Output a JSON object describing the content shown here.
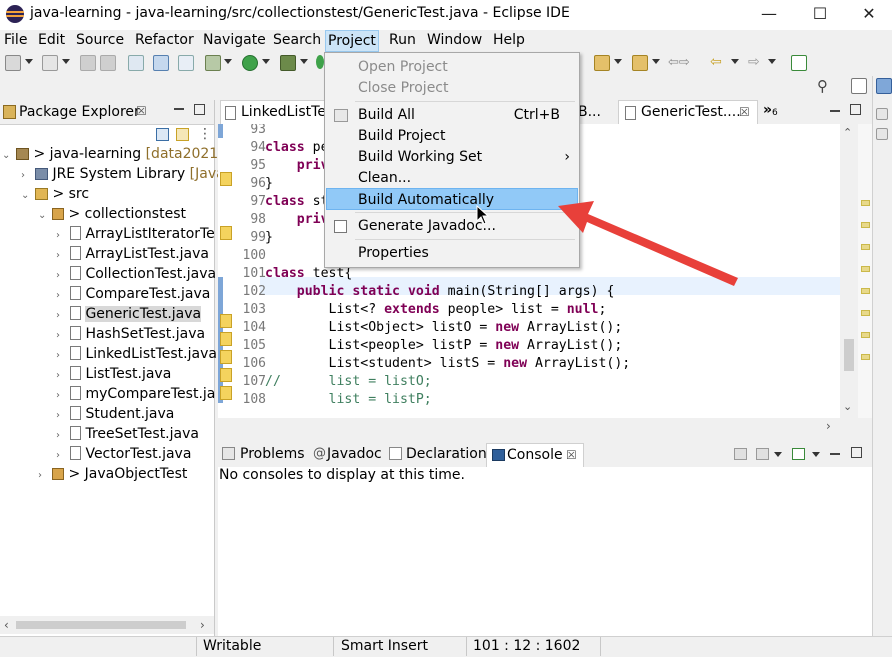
{
  "window": {
    "title": "java-learning - java-learning/src/collectionstest/GenericTest.java - Eclipse IDE",
    "minimize": "—",
    "maximize": "☐",
    "close": "✕"
  },
  "menubar": [
    "File",
    "Edit",
    "Source",
    "Refactor",
    "Navigate",
    "Search",
    "Project",
    "Run",
    "Window",
    "Help"
  ],
  "project_menu": {
    "items": [
      {
        "label": "Open Project",
        "disabled": true
      },
      {
        "label": "Close Project",
        "disabled": true
      },
      {
        "label": "Build All",
        "accel": "Ctrl+B"
      },
      {
        "label": "Build Project"
      },
      {
        "label": "Build Working Set",
        "submenu": "›"
      },
      {
        "label": "Clean..."
      },
      {
        "label": "Build Automatically",
        "highlighted": true
      },
      {
        "label": "Generate Javadoc..."
      },
      {
        "label": "Properties"
      }
    ]
  },
  "package_explorer": {
    "title": "Package Explorer",
    "close_glyph": "☒",
    "tree": [
      {
        "label": "> java-learning",
        "suffix": "[data20212",
        "icon": "project-icon"
      },
      {
        "label": "JRE System Library",
        "suffix": "[JavaS",
        "icon": "library-icon"
      },
      {
        "label": "> src",
        "icon": "source-folder-icon"
      },
      {
        "label": "> collectionstest",
        "icon": "package-icon"
      },
      {
        "label": "ArrayListIteratorTe",
        "icon": "java-file-icon"
      },
      {
        "label": "ArrayListTest.java",
        "icon": "java-file-icon"
      },
      {
        "label": "CollectionTest.java",
        "icon": "java-file-icon"
      },
      {
        "label": "CompareTest.java",
        "icon": "java-file-icon"
      },
      {
        "label": "GenericTest.java",
        "icon": "java-file-icon",
        "selected": true
      },
      {
        "label": "HashSetTest.java",
        "icon": "java-file-icon"
      },
      {
        "label": "LinkedListTest.java",
        "icon": "java-file-icon"
      },
      {
        "label": "ListTest.java",
        "icon": "java-file-icon"
      },
      {
        "label": "myCompareTest.ja",
        "icon": "java-file-icon"
      },
      {
        "label": "Student.java",
        "icon": "java-file-icon"
      },
      {
        "label": "TreeSetTest.java",
        "icon": "java-file-icon"
      },
      {
        "label": "VectorTest.java",
        "icon": "java-file-icon"
      },
      {
        "label": "> JavaObjectTest",
        "icon": "package-icon"
      }
    ]
  },
  "editor": {
    "tabs": [
      {
        "label": "LinkedListTe..."
      },
      {
        "label": "B..."
      },
      {
        "label": "GenericTest....",
        "active": true,
        "close": "☒"
      }
    ],
    "overflow_label": "»",
    "overflow_count": "6",
    "lines": [
      {
        "n": "93",
        "tokens": [
          {
            "t": ""
          }
        ]
      },
      {
        "n": "94",
        "tokens": [
          {
            "t": "class",
            "k": "kw"
          },
          {
            "t": " pe"
          }
        ]
      },
      {
        "n": "95",
        "tokens": [
          {
            "t": "    "
          },
          {
            "t": "priv",
            "k": "kw"
          }
        ]
      },
      {
        "n": "96",
        "tokens": [
          {
            "t": "}"
          }
        ]
      },
      {
        "n": "97",
        "tokens": [
          {
            "t": "class",
            "k": "kw"
          },
          {
            "t": " st"
          }
        ]
      },
      {
        "n": "98",
        "tokens": [
          {
            "t": "    "
          },
          {
            "t": "priv",
            "k": "kw"
          }
        ]
      },
      {
        "n": "99",
        "tokens": [
          {
            "t": "}"
          }
        ]
      },
      {
        "n": "100",
        "tokens": [
          {
            "t": ""
          }
        ]
      },
      {
        "n": "101",
        "tokens": [
          {
            "t": "class",
            "k": "kw"
          },
          {
            "t": " test{"
          }
        ]
      },
      {
        "n": "102",
        "tokens": [
          {
            "t": "    "
          },
          {
            "t": "public",
            "k": "kw"
          },
          {
            "t": " "
          },
          {
            "t": "static",
            "k": "kw"
          },
          {
            "t": " "
          },
          {
            "t": "void",
            "k": "kw"
          },
          {
            "t": " main(String[] args) {"
          }
        ]
      },
      {
        "n": "103",
        "tokens": [
          {
            "t": "        List<? "
          },
          {
            "t": "extends",
            "k": "kw"
          },
          {
            "t": " people> list = "
          },
          {
            "t": "null",
            "k": "kw"
          },
          {
            "t": ";"
          }
        ]
      },
      {
        "n": "104",
        "tokens": [
          {
            "t": "        List<Object> listO = "
          },
          {
            "t": "new",
            "k": "kw"
          },
          {
            "t": " ArrayList();"
          }
        ]
      },
      {
        "n": "105",
        "tokens": [
          {
            "t": "        List<people> listP = "
          },
          {
            "t": "new",
            "k": "kw"
          },
          {
            "t": " ArrayList();"
          }
        ]
      },
      {
        "n": "106",
        "tokens": [
          {
            "t": "        List<student> listS = "
          },
          {
            "t": "new",
            "k": "kw"
          },
          {
            "t": " ArrayList();"
          }
        ]
      },
      {
        "n": "107",
        "tokens": [
          {
            "t": "//      list = listO;",
            "k": "cm"
          }
        ]
      },
      {
        "n": "108",
        "tokens": [
          {
            "t": "        "
          },
          {
            "t": "list = listP;",
            "k": "cm"
          }
        ]
      }
    ]
  },
  "bottom_panel": {
    "tabs": [
      "Problems",
      "Javadoc",
      "Declaration",
      "Console"
    ],
    "active_tab": "Console",
    "console_close": "☒",
    "console_message": "No consoles to display at this time."
  },
  "statusbar": {
    "writable": "Writable",
    "insert_mode": "Smart Insert",
    "position": "101 : 12 : 1602"
  },
  "colors": {
    "annotation_arrow": "#e8403a",
    "menu_highlight": "#91c9f7",
    "keyword": "#7f0055",
    "comment": "#3f7f5f"
  }
}
